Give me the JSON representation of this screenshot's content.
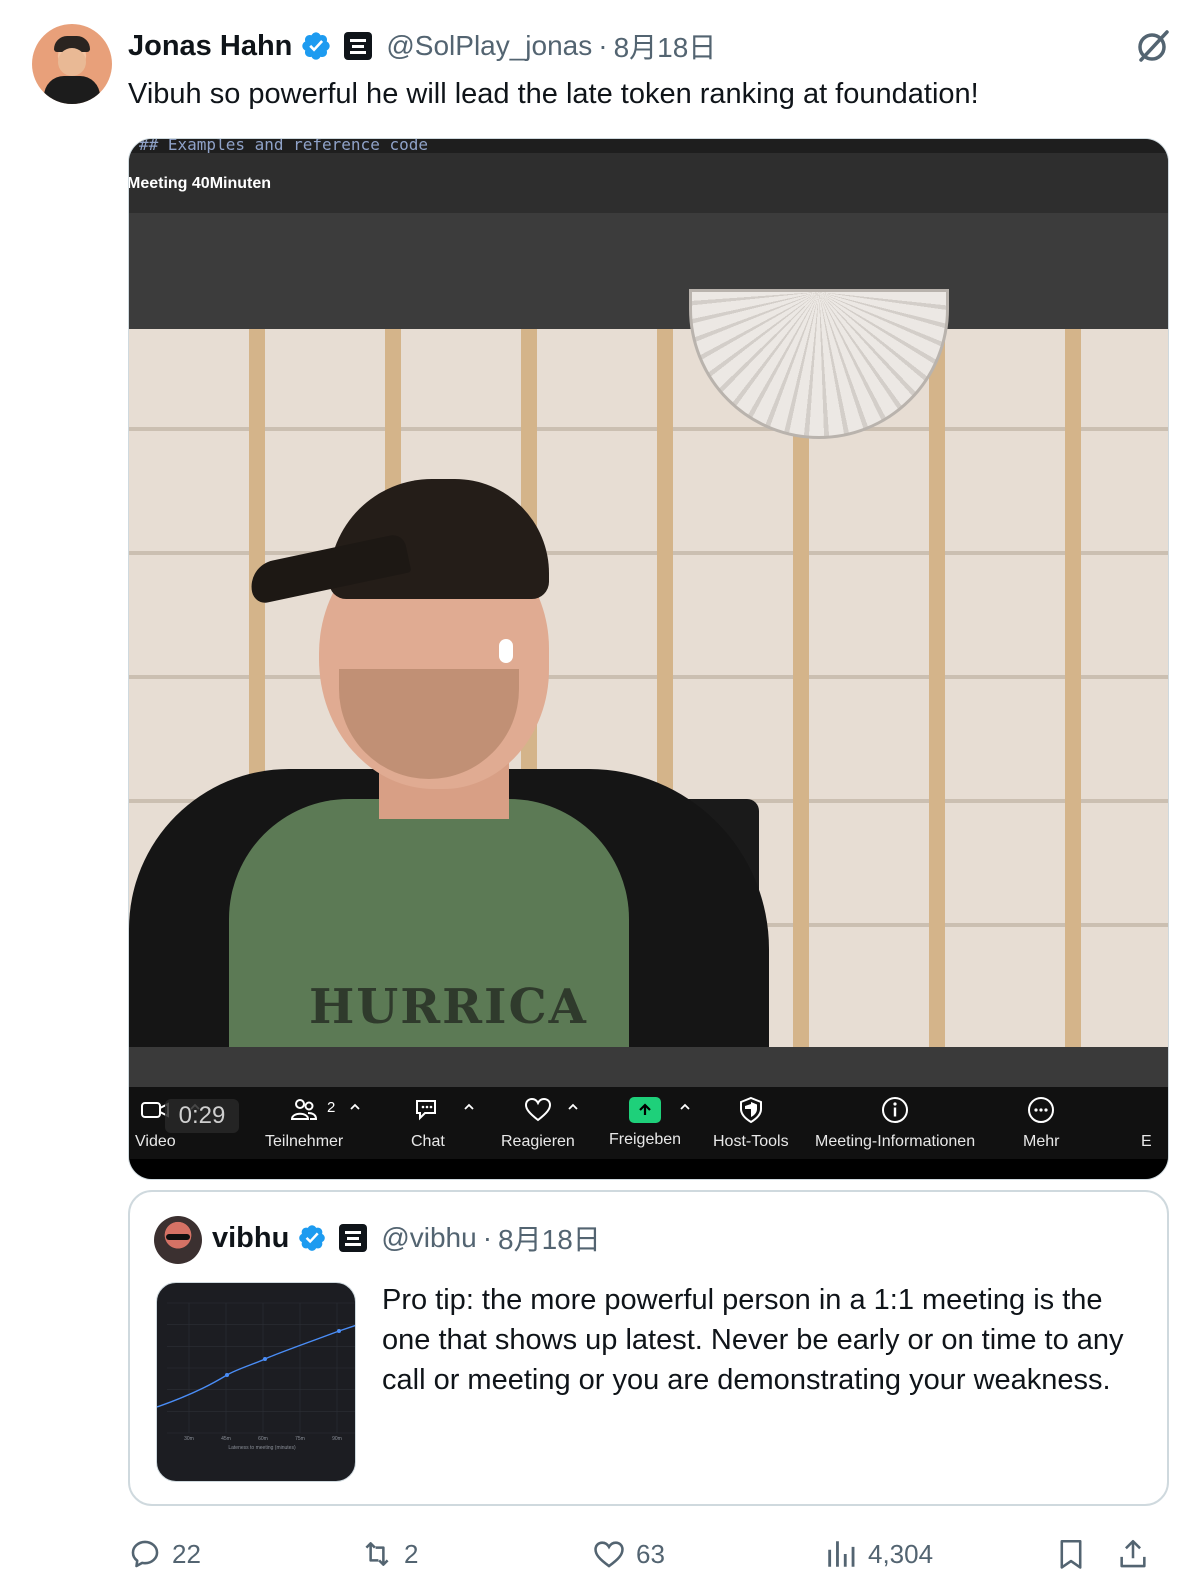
{
  "tweet": {
    "author_name": "Jonas Hahn",
    "handle": "@SolPlay_jonas",
    "separator": "·",
    "date": "8月18日",
    "text": "Vibuh so powerful he will lead the late token ranking at foundation!"
  },
  "video": {
    "code_text": "## Examples and reference code",
    "meeting_label": "Meeting  40Minuten",
    "shirt_print": "HURRICA",
    "timer": "0:29",
    "participant_count": "2",
    "toolbar": [
      {
        "id": "video",
        "label": "Video",
        "icon": "video-camera-icon"
      },
      {
        "id": "participants",
        "label": "Teilnehmer",
        "icon": "participants-icon"
      },
      {
        "id": "chat",
        "label": "Chat",
        "icon": "chat-icon"
      },
      {
        "id": "react",
        "label": "Reagieren",
        "icon": "heart-icon"
      },
      {
        "id": "share",
        "label": "Freigeben",
        "icon": "share-screen-icon"
      },
      {
        "id": "host",
        "label": "Host-Tools",
        "icon": "shield-icon"
      },
      {
        "id": "info",
        "label": "Meeting-Informationen",
        "icon": "info-icon"
      },
      {
        "id": "more",
        "label": "Mehr",
        "icon": "more-icon"
      },
      {
        "id": "end",
        "label": "E",
        "icon": ""
      }
    ],
    "share_color": "#1ed07a"
  },
  "quote": {
    "author_name": "vibhu",
    "handle": "@vibhu",
    "separator": "·",
    "date": "8月18日",
    "text": "Pro tip: the more powerful person in a 1:1 meeting is the one that shows up latest. Never be early or on time to any call or meeting or you are demonstrating your weakness.",
    "chart_data": {
      "type": "line",
      "categories": [
        "30m",
        "45m",
        "60m",
        "75m",
        "90m"
      ],
      "xlabel": "Lateness to meeting (minutes)",
      "series_color": "#4a8df6"
    }
  },
  "actions": {
    "replies": "22",
    "reposts": "2",
    "likes": "63",
    "views": "4,304"
  },
  "colors": {
    "verified_blue": "#1d9bf0",
    "secondary_text": "#536471",
    "primary_text": "#0f1419"
  }
}
